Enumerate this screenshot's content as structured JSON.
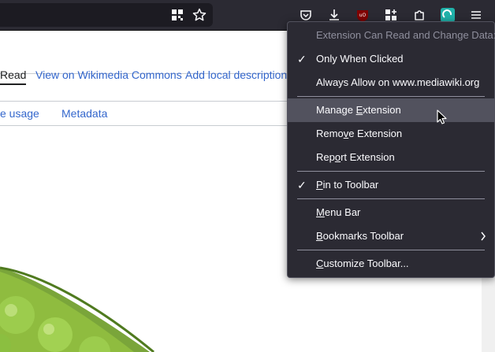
{
  "toolbar": {
    "icons": [
      "qr-code-icon",
      "bookmark-star-icon",
      "pocket-icon",
      "download-icon",
      "ublock-origin-icon",
      "extension-grid-icon",
      "extensions-puzzle-icon",
      "extension-teal-icon",
      "hamburger-menu-icon"
    ],
    "ublock_color": "#800000",
    "teal_color": "#20b2aa"
  },
  "page": {
    "tabs": [
      {
        "label": "Read",
        "selected": true
      },
      {
        "label": "View on Wikimedia Commons"
      },
      {
        "label": "Add local description"
      }
    ],
    "subtabs": [
      {
        "label": "e usage"
      },
      {
        "label": "Metadata"
      }
    ]
  },
  "menu": {
    "header": "Extension Can Read and Change Data:",
    "only_when_clicked": {
      "label": "Only When Clicked",
      "checked": true
    },
    "always_allow": "Always Allow on www.mediawiki.org",
    "manage_pre": "Manage ",
    "manage_key": "E",
    "manage_post": "xtension",
    "remove_pre": "Remo",
    "remove_key": "v",
    "remove_post": "e Extension",
    "report_pre": "Rep",
    "report_key": "o",
    "report_post": "rt Extension",
    "pin_key": "P",
    "pin_post": "in to Toolbar",
    "pin_checked": true,
    "menubar_key": "M",
    "menubar_post": "enu Bar",
    "bookmarks_key": "B",
    "bookmarks_post": "ookmarks Toolbar",
    "customize_key": "C",
    "customize_post": "ustomize Toolbar..."
  },
  "colors": {
    "menu_bg": "#2b2a33",
    "hover_bg": "#52525e",
    "link": "#3366cc"
  }
}
